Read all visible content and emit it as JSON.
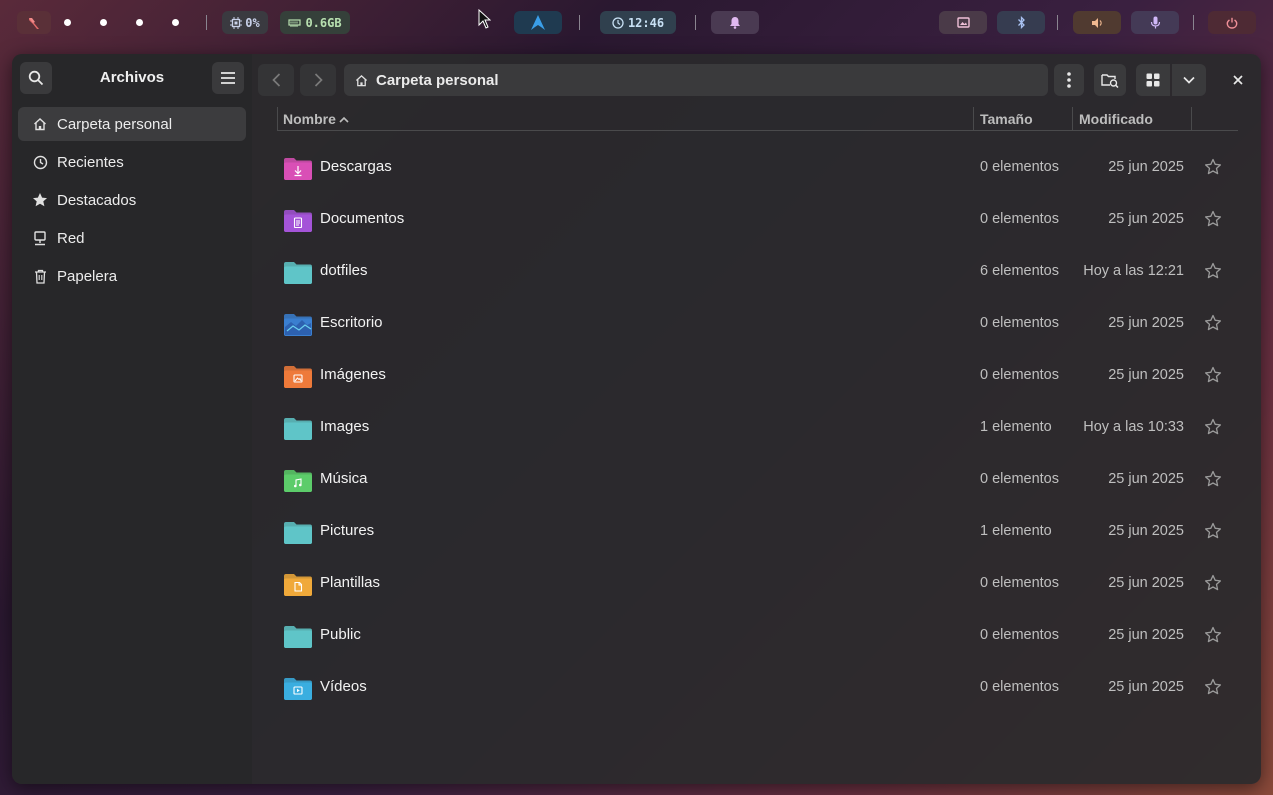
{
  "topbar": {
    "cpu": "0%",
    "ram": "0.6GB",
    "clock": "12:46",
    "icons": [
      "app-logo-icon",
      "cpu-icon",
      "memory-icon",
      "arch-logo-icon",
      "clock-icon",
      "bell-icon",
      "screenshot-icon",
      "bluetooth-icon",
      "volume-icon",
      "microphone-icon",
      "power-icon"
    ]
  },
  "sidebar": {
    "title": "Archivos",
    "items": [
      {
        "label": "Carpeta personal",
        "icon": "home-icon",
        "active": true
      },
      {
        "label": "Recientes",
        "icon": "clock-icon",
        "active": false
      },
      {
        "label": "Destacados",
        "icon": "star-icon",
        "active": false
      },
      {
        "label": "Red",
        "icon": "network-icon",
        "active": false
      },
      {
        "label": "Papelera",
        "icon": "trash-icon",
        "active": false
      }
    ]
  },
  "header": {
    "path": "Carpeta personal"
  },
  "columns": {
    "name": "Nombre",
    "size": "Tamaño",
    "modified": "Modificado"
  },
  "files": [
    {
      "name": "Descargas",
      "size": "0 elementos",
      "modified": "25 jun 2025",
      "folder_color": "#d94fb6",
      "emblem": "download"
    },
    {
      "name": "Documentos",
      "size": "0 elementos",
      "modified": "25 jun 2025",
      "folder_color": "#a454d8",
      "emblem": "document"
    },
    {
      "name": "dotfiles",
      "size": "6 elementos",
      "modified": "Hoy a las 12:21",
      "folder_color": "#5fc5c8",
      "emblem": "none"
    },
    {
      "name": "Escritorio",
      "size": "0 elementos",
      "modified": "25 jun 2025",
      "folder_color": "#3a7fd0",
      "emblem": "desktop"
    },
    {
      "name": "Imágenes",
      "size": "0 elementos",
      "modified": "25 jun 2025",
      "folder_color": "#ee7a3a",
      "emblem": "image"
    },
    {
      "name": "Images",
      "size": "1 elemento",
      "modified": "Hoy a las 10:33",
      "folder_color": "#5fc5c8",
      "emblem": "none"
    },
    {
      "name": "Música",
      "size": "0 elementos",
      "modified": "25 jun 2025",
      "folder_color": "#5ccc6a",
      "emblem": "music"
    },
    {
      "name": "Pictures",
      "size": "1 elemento",
      "modified": "25 jun 2025",
      "folder_color": "#5fc5c8",
      "emblem": "none"
    },
    {
      "name": "Plantillas",
      "size": "0 elementos",
      "modified": "25 jun 2025",
      "folder_color": "#f0a93a",
      "emblem": "template"
    },
    {
      "name": "Public",
      "size": "0 elementos",
      "modified": "25 jun 2025",
      "folder_color": "#5fc5c8",
      "emblem": "none"
    },
    {
      "name": "Vídeos",
      "size": "0 elementos",
      "modified": "25 jun 2025",
      "folder_color": "#3aaee0",
      "emblem": "video"
    }
  ]
}
